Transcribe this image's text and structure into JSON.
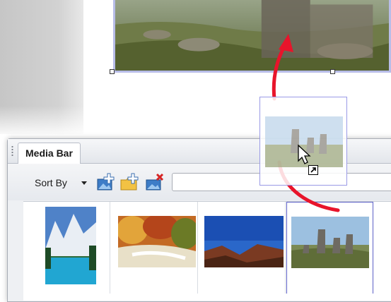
{
  "media_bar": {
    "tab_label": "Media Bar",
    "sort_by_label": "Sort By",
    "search_value": ""
  },
  "toolbar_icons": [
    "add-photo-icon",
    "add-folder-icon",
    "remove-photo-icon"
  ],
  "thumbnails": [
    {
      "subject": "mountain-lake"
    },
    {
      "subject": "autumn-river"
    },
    {
      "subject": "canyon-sky"
    },
    {
      "subject": "easter-island-moai",
      "selected": true
    }
  ],
  "colors": {
    "selection_border": "#5b5fc7",
    "drag_arrow": "#e8142b",
    "canvas_frame": "#b8bde8"
  }
}
